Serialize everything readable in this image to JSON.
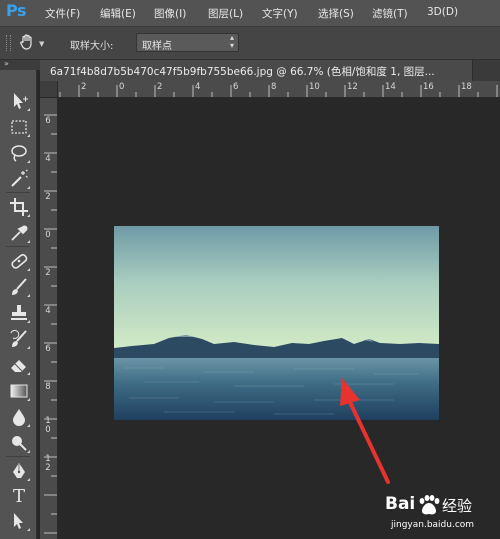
{
  "app": {
    "logo": "Ps"
  },
  "menu": {
    "items": [
      "文件(F)",
      "编辑(E)",
      "图像(I)",
      "图层(L)",
      "文字(Y)",
      "选择(S)",
      "滤镜(T)",
      "3D(D)"
    ]
  },
  "options": {
    "tool_icon": "hand-eyedropper-icon",
    "sample_size_label": "取样大小:",
    "sample_size_value": "取样点"
  },
  "document": {
    "tab_title": "6a71f4b8d7b5b470c47f5b9fb755be66.jpg @ 66.7% (色相/饱和度 1, 图层..."
  },
  "rulers": {
    "top": [
      "2",
      "0",
      "2",
      "4",
      "6",
      "8",
      "10",
      "12",
      "14",
      "16",
      "18"
    ],
    "left": [
      "6",
      "4",
      "2",
      "0",
      "2",
      "4",
      "6",
      "8",
      "1\n0",
      "1\n2"
    ]
  },
  "toolbox": {
    "tools": [
      "move-tool-icon",
      "marquee-tool-icon",
      "lasso-tool-icon",
      "magic-wand-icon",
      "crop-tool-icon",
      "eyedropper-icon",
      "healing-brush-icon",
      "brush-tool-icon",
      "clone-stamp-icon",
      "history-brush-icon",
      "eraser-tool-icon",
      "gradient-tool-icon",
      "blur-tool-icon",
      "dodge-tool-icon",
      "pen-tool-icon",
      "type-tool-icon",
      "path-selection-icon"
    ],
    "type_tool_glyph": "T"
  },
  "watermark": {
    "brand": "Bai",
    "brand_suffix": "经验",
    "url": "jingyan.baidu.com"
  },
  "colors": {
    "accent": "#3aa0e8",
    "arrow": "#e8322e"
  }
}
